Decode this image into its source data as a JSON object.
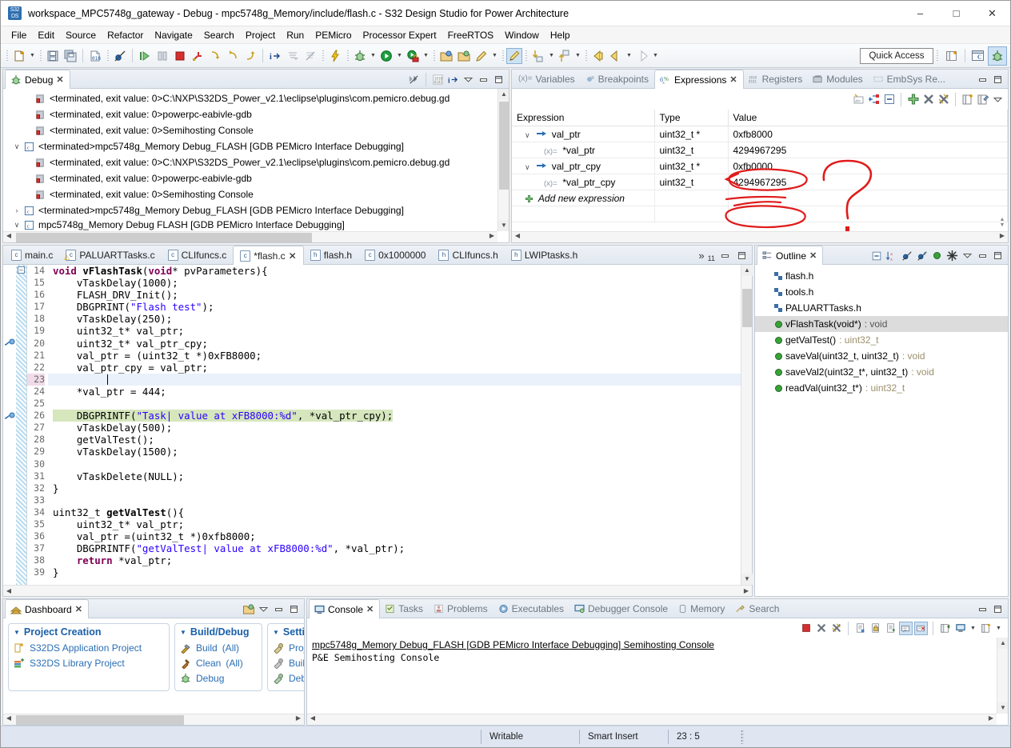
{
  "window": {
    "title": "workspace_MPC5748g_gateway - Debug - mpc5748g_Memory/include/flash.c - S32 Design Studio for Power Architecture",
    "app_icon": "s32ds-icon",
    "minimize": "–",
    "maximize": "□",
    "close": "✕"
  },
  "menubar": {
    "items": [
      {
        "label": "File"
      },
      {
        "label": "Edit"
      },
      {
        "label": "Source"
      },
      {
        "label": "Refactor"
      },
      {
        "label": "Navigate"
      },
      {
        "label": "Search"
      },
      {
        "label": "Project"
      },
      {
        "label": "Run"
      },
      {
        "label": "PEMicro"
      },
      {
        "label": "Processor Expert"
      },
      {
        "label": "FreeRTOS"
      },
      {
        "label": "Window"
      },
      {
        "label": "Help"
      }
    ]
  },
  "toolbar": {
    "quick_access": "Quick Access",
    "icons": [
      "new-file-icon",
      "save-icon",
      "save-all-icon",
      "binary-010-icon",
      "skip-breakpoints-icon",
      "resume-icon",
      "suspend-icon",
      "terminate-icon",
      "disconnect-icon",
      "step-into-icon",
      "step-over-icon",
      "step-return-icon",
      "instruction-stepping-icon",
      "drop-to-frame-icon",
      "use-step-filters-icon",
      "flash-icon",
      "debug-icon",
      "run-icon",
      "run-secure-icon",
      "open-project-icon",
      "open-project-2-icon",
      "pencil-icon",
      "highlight-icon",
      "download-icon",
      "upload-icon",
      "back-icon",
      "forward-icon",
      "next-icon"
    ],
    "perspective": [
      "open-perspective-icon",
      "c-cpp-perspective-icon",
      "debug-perspective-icon"
    ]
  },
  "debug_view": {
    "tab_label": "Debug",
    "tab_icon": "debug-icon",
    "toolbar_icons": [
      "collapse-all-icon",
      "binary-view-icon",
      "instruction-stepping-icon",
      "view-menu-icon",
      "minimize-icon",
      "maximize-icon"
    ],
    "tree": [
      {
        "indent": 1,
        "expander": "",
        "icon": "process-icon",
        "label": "<terminated, exit value: 0>C:\\NXP\\S32DS_Power_v2.1\\eclipse\\plugins\\com.pemicro.debug.gd"
      },
      {
        "indent": 1,
        "expander": "",
        "icon": "process-icon",
        "label": "<terminated, exit value: 0>powerpc-eabivle-gdb"
      },
      {
        "indent": 1,
        "expander": "",
        "icon": "process-icon",
        "label": "<terminated, exit value: 0>Semihosting Console"
      },
      {
        "indent": 0,
        "expander": "∨",
        "icon": "launch-c-icon",
        "label": "<terminated>mpc5748g_Memory Debug_FLASH [GDB PEMicro Interface Debugging]"
      },
      {
        "indent": 1,
        "expander": "",
        "icon": "process-icon",
        "label": "<terminated, exit value: 0>C:\\NXP\\S32DS_Power_v2.1\\eclipse\\plugins\\com.pemicro.debug.gd"
      },
      {
        "indent": 1,
        "expander": "",
        "icon": "process-icon",
        "label": "<terminated, exit value: 0>powerpc-eabivle-gdb"
      },
      {
        "indent": 1,
        "expander": "",
        "icon": "process-icon",
        "label": "<terminated, exit value: 0>Semihosting Console"
      },
      {
        "indent": 0,
        "expander": "›",
        "icon": "launch-c-icon",
        "label": "<terminated>mpc5748g_Memory Debug_FLASH [GDB PEMicro Interface Debugging]"
      },
      {
        "indent": 0,
        "expander": "∨",
        "icon": "launch-c-icon",
        "label": "mpc5748g_Memory Debug FLASH [GDB PEMicro Interface Debugging]"
      }
    ]
  },
  "expressions_view": {
    "tabs": [
      {
        "label": "Variables",
        "icon": "variables-icon",
        "active": false
      },
      {
        "label": "Breakpoints",
        "icon": "breakpoints-icon",
        "active": false
      },
      {
        "label": "Expressions",
        "icon": "expressions-icon",
        "active": true
      },
      {
        "label": "Registers",
        "icon": "registers-icon",
        "active": false
      },
      {
        "label": "Modules",
        "icon": "modules-icon",
        "active": false
      },
      {
        "label": "EmbSys Re...",
        "icon": "embsys-icon",
        "active": false
      }
    ],
    "toolbar_icons": [
      "show-type-names-icon",
      "show-logical-structure-icon",
      "collapse-all-icon",
      "add-expression-icon",
      "remove-icon",
      "remove-all-icon",
      "new-watchlist-icon",
      "edit-watchlist-icon",
      "view-menu-icon"
    ],
    "columns": [
      "Expression",
      "Type",
      "Value"
    ],
    "rows": [
      {
        "indent": 1,
        "expander": "∨",
        "icon": "pointer-icon",
        "expression": "val_ptr",
        "type": "uint32_t *",
        "value": "0xfb8000",
        "annotated": false
      },
      {
        "indent": 2,
        "expander": "",
        "icon": "variable-icon",
        "expression": "*val_ptr",
        "type": "uint32_t",
        "value": "4294967295",
        "annotated": true
      },
      {
        "indent": 1,
        "expander": "∨",
        "icon": "pointer-icon",
        "expression": "val_ptr_cpy",
        "type": "uint32_t *",
        "value": "0xfb0000",
        "annotated": false
      },
      {
        "indent": 2,
        "expander": "",
        "icon": "variable-icon",
        "expression": "*val_ptr_cpy",
        "type": "uint32_t",
        "value": "4294967295",
        "annotated": true
      },
      {
        "indent": 1,
        "expander": "",
        "icon": "add-icon",
        "expression": "Add new expression",
        "type": "",
        "value": "",
        "annotated": false
      }
    ],
    "annotation_color": "#e01b1b",
    "annotation_glyph": "?"
  },
  "editor": {
    "tabs": [
      {
        "label": "main.c",
        "icon": "c-file-icon",
        "active": false,
        "dirty": false
      },
      {
        "label": "PALUARTTasks.c",
        "icon": "c-file-warning-icon",
        "active": false,
        "dirty": false
      },
      {
        "label": "CLIfuncs.c",
        "icon": "c-file-icon",
        "active": false,
        "dirty": false
      },
      {
        "label": "*flash.c",
        "icon": "c-file-icon",
        "active": true,
        "dirty": true
      },
      {
        "label": "flash.h",
        "icon": "h-file-icon",
        "active": false,
        "dirty": false
      },
      {
        "label": "0x1000000",
        "icon": "c-file-icon",
        "active": false,
        "dirty": false
      },
      {
        "label": "CLIfuncs.h",
        "icon": "h-file-icon",
        "active": false,
        "dirty": false
      },
      {
        "label": "LWIPtasks.h",
        "icon": "h-file-icon",
        "active": false,
        "dirty": false
      }
    ],
    "overflow_indicator": "»",
    "overflow_count": "11",
    "first_line": 14,
    "current_line": 23,
    "highlight_line": 26,
    "lines": [
      {
        "n": 14,
        "fold": true,
        "text": "void vFlashTask(void* pvParameters){"
      },
      {
        "n": 15,
        "text": "    vTaskDelay(1000);"
      },
      {
        "n": 16,
        "text": "    FLASH_DRV_Init();"
      },
      {
        "n": 17,
        "text": "    DBGPRINT(\"Flash test\");"
      },
      {
        "n": 18,
        "text": "    vTaskDelay(250);"
      },
      {
        "n": 19,
        "text": "    uint32_t* val_ptr;"
      },
      {
        "n": 20,
        "text": "    uint32_t* val_ptr_cpy;",
        "marker": "breakpoint-disabled"
      },
      {
        "n": 21,
        "text": "    val_ptr = (uint32_t *)0xFB8000;"
      },
      {
        "n": 22,
        "text": "    val_ptr_cpy = val_ptr;"
      },
      {
        "n": 23,
        "text": "",
        "caret": true
      },
      {
        "n": 24,
        "text": "    *val_ptr = 444;"
      },
      {
        "n": 25,
        "text": ""
      },
      {
        "n": 26,
        "text": "    DBGPRINTF(\"Task| value at xFB8000:%d\", *val_ptr_cpy);",
        "marker": "breakpoint-disabled"
      },
      {
        "n": 27,
        "text": "    vTaskDelay(500);"
      },
      {
        "n": 28,
        "text": "    getValTest();"
      },
      {
        "n": 29,
        "text": "    vTaskDelay(1500);"
      },
      {
        "n": 30,
        "text": ""
      },
      {
        "n": 31,
        "text": "    vTaskDelete(NULL);"
      },
      {
        "n": 32,
        "text": "}"
      },
      {
        "n": 33,
        "text": ""
      },
      {
        "n": 34,
        "text": "uint32_t getValTest(){"
      },
      {
        "n": 35,
        "text": "    uint32_t* val_ptr;"
      },
      {
        "n": 36,
        "text": "    val_ptr =(uint32_t *)0xfb8000;"
      },
      {
        "n": 37,
        "text": "    DBGPRINTF(\"getValTest| value at xFB8000:%d\", *val_ptr);"
      },
      {
        "n": 38,
        "text": "    return *val_ptr;"
      },
      {
        "n": 39,
        "text": "}"
      }
    ]
  },
  "outline_view": {
    "tab_label": "Outline",
    "tab_icon": "outline-icon",
    "toolbar_icons": [
      "collapse-all-icon",
      "sort-icon",
      "hide-fields-icon",
      "hide-static-icon",
      "hide-nonpublic-icon",
      "filters-icon",
      "view-menu-icon",
      "minimize-icon",
      "maximize-icon"
    ],
    "items": [
      {
        "icon": "include-icon",
        "label": "flash.h",
        "type": "",
        "selected": false
      },
      {
        "icon": "include-icon",
        "label": "tools.h",
        "type": "",
        "selected": false
      },
      {
        "icon": "include-icon",
        "label": "PALUARTTasks.h",
        "type": "",
        "selected": false
      },
      {
        "icon": "function-icon",
        "label": "vFlashTask(void*)",
        "type": ": void",
        "selected": true
      },
      {
        "icon": "function-icon",
        "label": "getValTest()",
        "type": ": uint32_t",
        "selected": false
      },
      {
        "icon": "function-icon",
        "label": "saveVal(uint32_t, uint32_t)",
        "type": ": void",
        "selected": false
      },
      {
        "icon": "function-icon",
        "label": "saveVal2(uint32_t*, uint32_t)",
        "type": ": void",
        "selected": false
      },
      {
        "icon": "function-icon",
        "label": "readVal(uint32_t*)",
        "type": ": uint32_t",
        "selected": false
      }
    ]
  },
  "dashboard_view": {
    "tab_label": "Dashboard",
    "tab_icon": "dashboard-icon",
    "toolbar_icons": [
      "open-dashboard-icon",
      "view-menu-icon",
      "minimize-icon",
      "maximize-icon"
    ],
    "sections": [
      {
        "title": "Project Creation",
        "links": [
          {
            "icon": "new-app-project-icon",
            "label": "S32DS Application Project"
          },
          {
            "icon": "new-lib-project-icon",
            "label": "S32DS Library Project"
          }
        ]
      },
      {
        "title": "Build/Debug",
        "links": [
          {
            "icon": "hammer-icon",
            "label": "Build",
            "suffix": "(All)"
          },
          {
            "icon": "broom-icon",
            "label": "Clean",
            "suffix": "(All)"
          },
          {
            "icon": "bug-icon",
            "label": "Debug",
            "suffix": ""
          }
        ]
      },
      {
        "title": "Settin",
        "links": [
          {
            "icon": "wrench-icon",
            "label": "Proj",
            "suffix": ""
          },
          {
            "icon": "wrench-icon",
            "label": "Buil",
            "suffix": ""
          },
          {
            "icon": "wrench-icon",
            "label": "Deb",
            "suffix": ""
          }
        ]
      }
    ]
  },
  "console_view": {
    "tabs": [
      {
        "label": "Console",
        "icon": "console-icon",
        "active": true
      },
      {
        "label": "Tasks",
        "icon": "tasks-icon",
        "active": false
      },
      {
        "label": "Problems",
        "icon": "problems-icon",
        "active": false
      },
      {
        "label": "Executables",
        "icon": "executables-icon",
        "active": false
      },
      {
        "label": "Debugger Console",
        "icon": "debugger-console-icon",
        "active": false
      },
      {
        "label": "Memory",
        "icon": "memory-icon",
        "active": false
      },
      {
        "label": "Search",
        "icon": "search-icon",
        "active": false
      }
    ],
    "toolbar_icons": [
      "terminate-icon",
      "remove-launch-icon",
      "remove-all-terminated-icon",
      "clear-console-icon",
      "scroll-lock-icon",
      "word-wrap-icon",
      "show-console-on-output-icon",
      "show-console-on-error-icon",
      "pin-console-icon",
      "display-selected-console-icon",
      "open-console-icon"
    ],
    "header": "mpc5748g_Memory Debug_FLASH [GDB PEMicro Interface Debugging] Semihosting Console",
    "body_lines": [
      "P&E Semihosting Console"
    ]
  },
  "statusbar": {
    "writable": "Writable",
    "insert_mode": "Smart Insert",
    "position": "23 : 5"
  }
}
